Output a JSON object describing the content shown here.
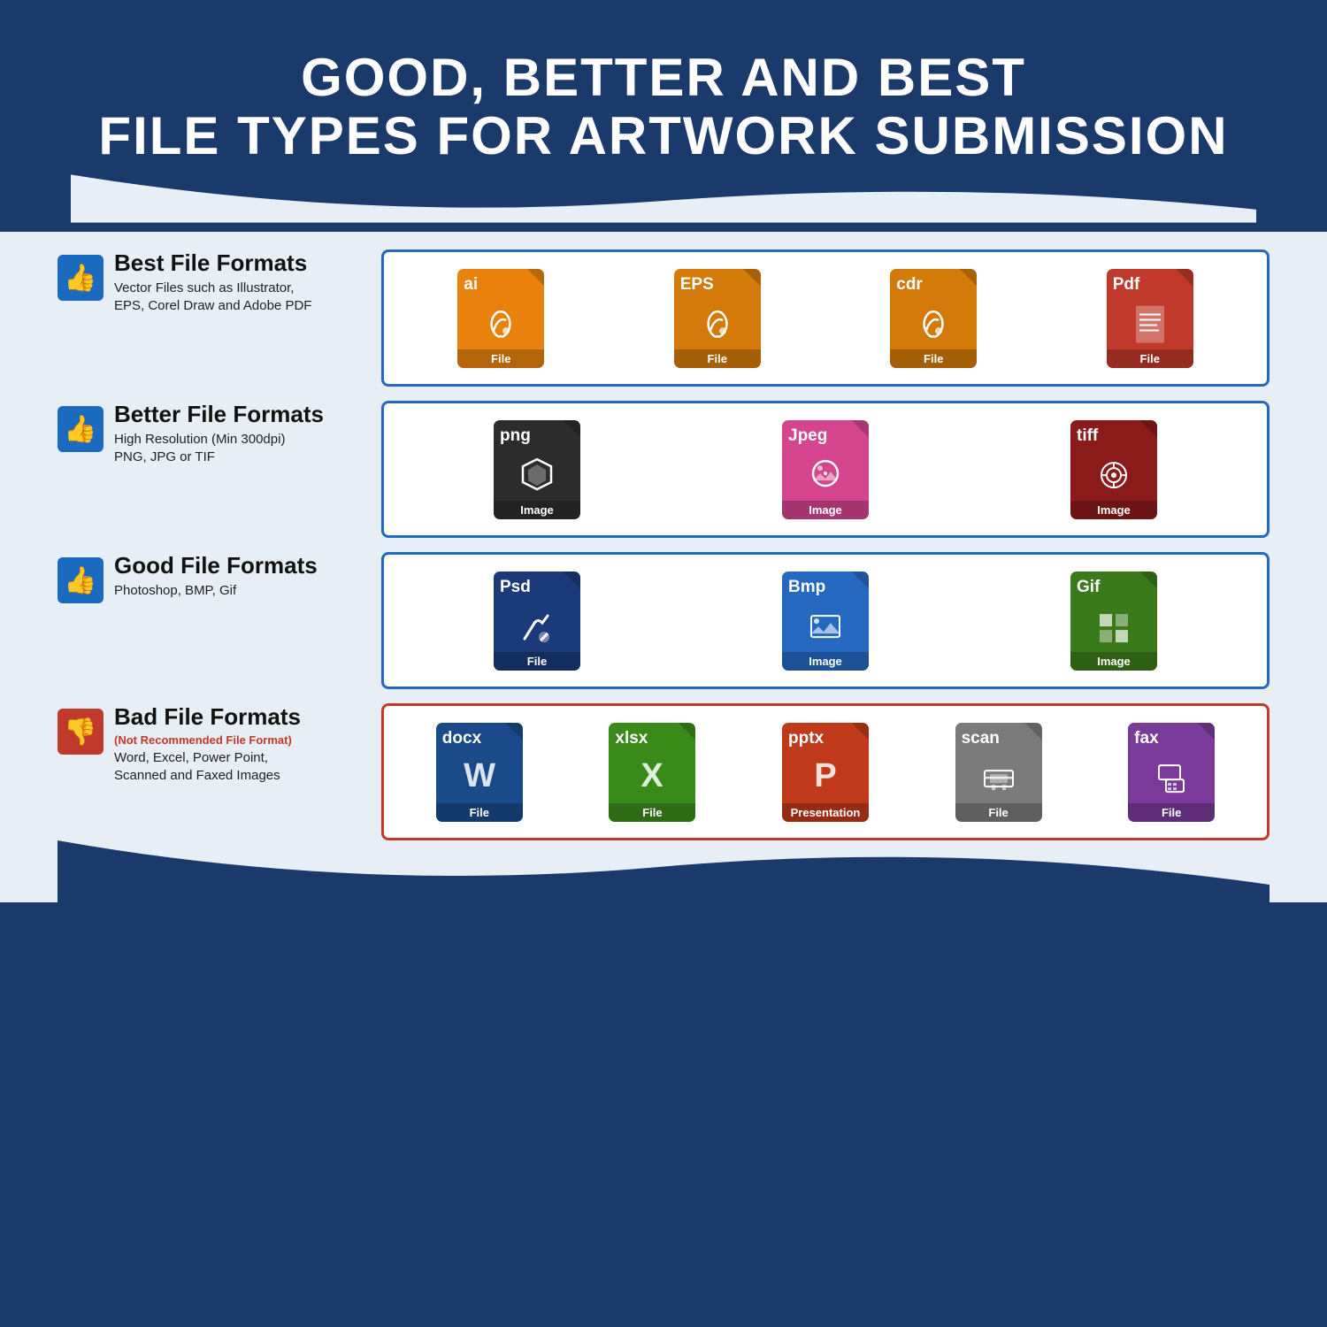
{
  "header": {
    "line1": "GOOD, BETTER AND BEST",
    "line2": "FILE TYPES FOR ARTWORK SUBMISSION"
  },
  "sections": [
    {
      "id": "best",
      "thumb": "up",
      "title": "Best File Formats",
      "subtitle": null,
      "desc": "Vector Files such as Illustrator,\nEPS, Corel Draw and Adobe PDF",
      "border": "blue",
      "files": [
        {
          "ext": "ai",
          "color": "#e8820c",
          "icon": "✏️",
          "label": "File"
        },
        {
          "ext": "EPS",
          "color": "#d47a0a",
          "icon": "✏️",
          "label": "File"
        },
        {
          "ext": "cdr",
          "color": "#d47a0a",
          "icon": "✏️",
          "label": "File"
        },
        {
          "ext": "Pdf",
          "color": "#c0392b",
          "icon": "📄",
          "label": "File"
        }
      ]
    },
    {
      "id": "better",
      "thumb": "up",
      "title": "Better File Formats",
      "subtitle": null,
      "desc": "High Resolution (Min 300dpi)\nPNG, JPG or TIF",
      "border": "blue",
      "files": [
        {
          "ext": "png",
          "color": "#2c2c2c",
          "icon": "✦",
          "label": "Image"
        },
        {
          "ext": "Jpeg",
          "color": "#d4458e",
          "icon": "📷",
          "label": "Image"
        },
        {
          "ext": "tiff",
          "color": "#8b1a1a",
          "icon": "⚙️",
          "label": "Image"
        }
      ]
    },
    {
      "id": "good",
      "thumb": "up",
      "title": "Good File Formats",
      "subtitle": null,
      "desc": "Photoshop, BMP, Gif",
      "border": "blue",
      "files": [
        {
          "ext": "Psd",
          "color": "#1a3a7a",
          "icon": "🖌️",
          "label": "File"
        },
        {
          "ext": "Bmp",
          "color": "#2468c0",
          "icon": "🖼️",
          "label": "Image"
        },
        {
          "ext": "Gif",
          "color": "#3a7a1a",
          "icon": "▦",
          "label": "Image"
        }
      ]
    },
    {
      "id": "bad",
      "thumb": "down",
      "title": "Bad File Formats",
      "subtitle": "(Not Recommended File Format)",
      "desc": "Word, Excel, Power Point,\nScanned and Faxed Images",
      "border": "red",
      "files": [
        {
          "ext": "docx",
          "color": "#1a4a8a",
          "icon": "W",
          "label": "File"
        },
        {
          "ext": "xlsx",
          "color": "#3a8a1a",
          "icon": "X",
          "label": "File"
        },
        {
          "ext": "pptx",
          "color": "#c0391a",
          "icon": "P",
          "label": "Presentation"
        },
        {
          "ext": "scan",
          "color": "#7a7a7a",
          "icon": "🖨",
          "label": "File"
        },
        {
          "ext": "fax",
          "color": "#7a3a9a",
          "icon": "📠",
          "label": "File"
        }
      ]
    }
  ],
  "thumbs": {
    "up": "👍",
    "down": "👎"
  }
}
